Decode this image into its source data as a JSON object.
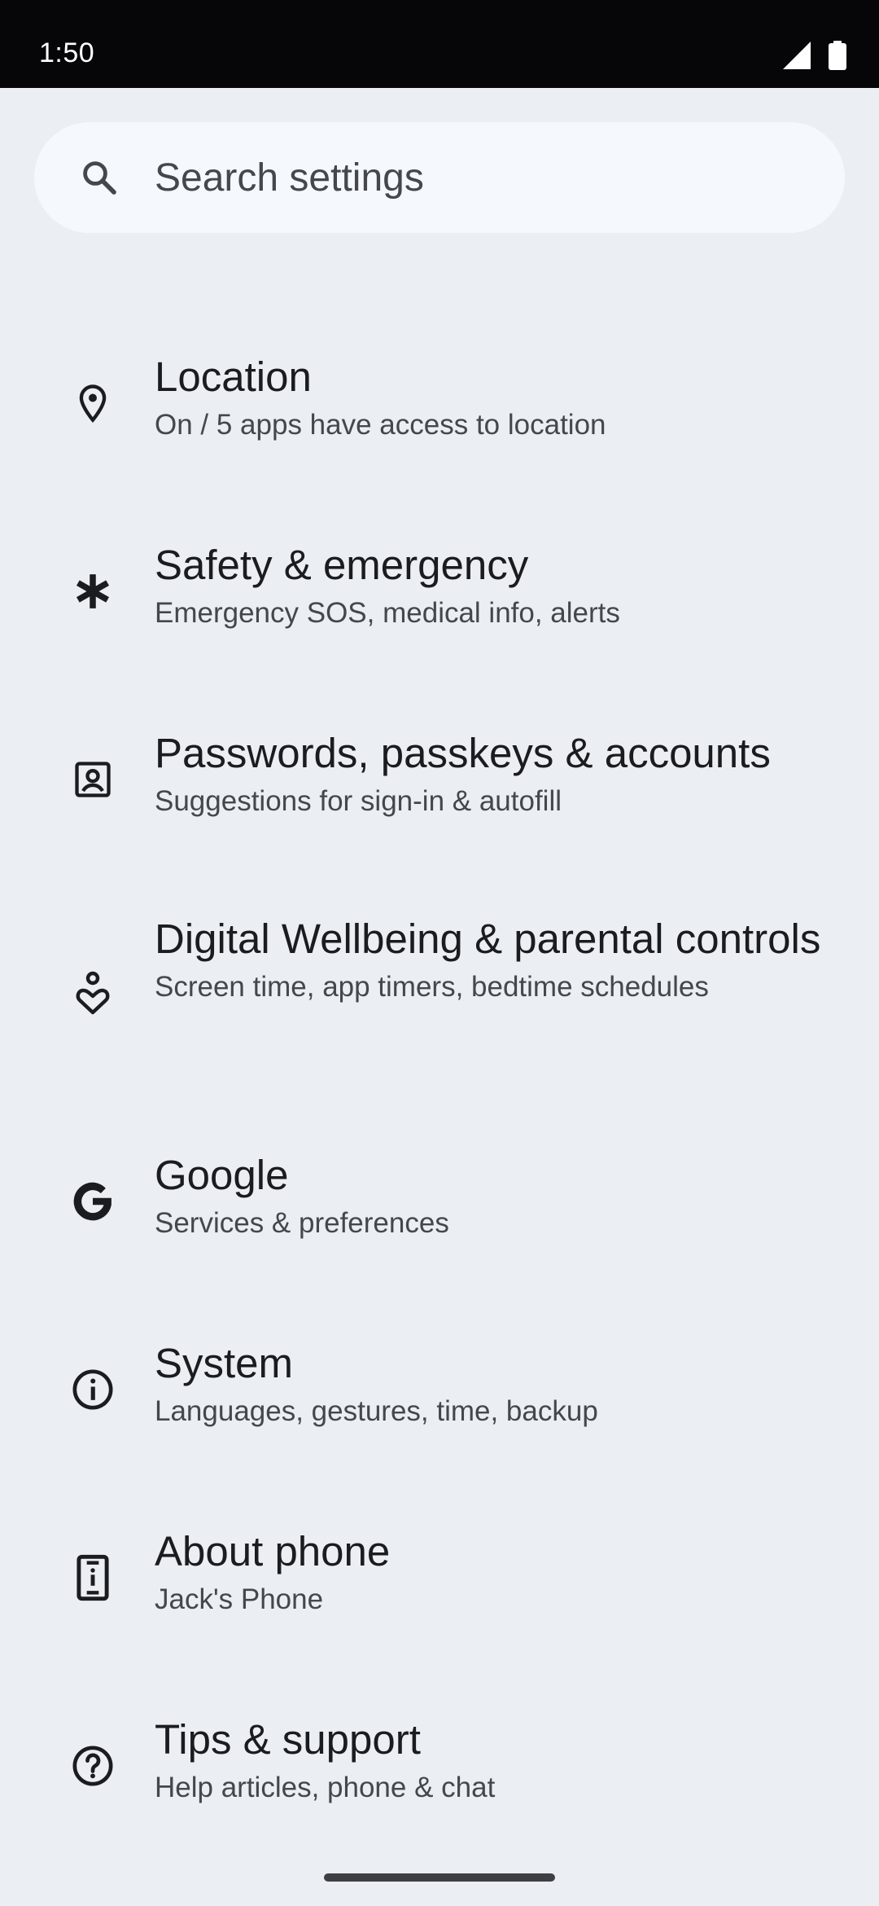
{
  "status_bar": {
    "time": "1:50",
    "icons": [
      "cell-signal-icon",
      "battery-icon"
    ]
  },
  "search": {
    "placeholder": "Search settings",
    "icon": "search-icon"
  },
  "items": [
    {
      "icon": "location-pin-icon",
      "title": "Location",
      "subtitle": "On / 5 apps have access to location"
    },
    {
      "icon": "asterisk-emergency-icon",
      "title": "Safety & emergency",
      "subtitle": "Emergency SOS, medical info, alerts"
    },
    {
      "icon": "account-box-icon",
      "title": "Passwords, passkeys & accounts",
      "subtitle": "Suggestions for sign-in & autofill"
    },
    {
      "icon": "wellbeing-icon",
      "title": "Digital Wellbeing & parental controls",
      "subtitle": "Screen time, app timers, bedtime schedules"
    },
    {
      "icon": "google-g-icon",
      "title": "Google",
      "subtitle": "Services & preferences"
    },
    {
      "icon": "info-icon",
      "title": "System",
      "subtitle": "Languages, gestures, time, backup"
    },
    {
      "icon": "phone-info-icon",
      "title": "About phone",
      "subtitle": "Jack's Phone"
    },
    {
      "icon": "help-icon",
      "title": "Tips & support",
      "subtitle": "Help articles, phone & chat"
    }
  ],
  "colors": {
    "background": "#ebeef3",
    "status_bar": "#060608",
    "search_bar": "#f5f8fd",
    "title_text": "#1b1c1f",
    "subtitle_text": "#44474c"
  }
}
